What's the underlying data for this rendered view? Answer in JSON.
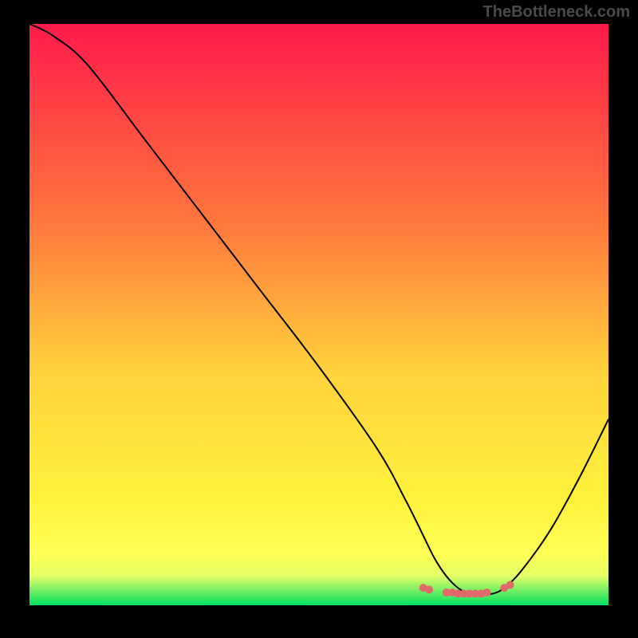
{
  "watermark": "TheBottleneck.com",
  "chart_data": {
    "type": "line",
    "title": "",
    "xlabel": "",
    "ylabel": "",
    "xlim": [
      0,
      100
    ],
    "ylim": [
      0,
      100
    ],
    "gradient_stops": [
      {
        "offset": 0,
        "color": "#ff1a4b"
      },
      {
        "offset": 35,
        "color": "#ff7a3c"
      },
      {
        "offset": 60,
        "color": "#ffd23c"
      },
      {
        "offset": 82,
        "color": "#fff23c"
      },
      {
        "offset": 91,
        "color": "#ffff55"
      },
      {
        "offset": 95,
        "color": "#e3ff66"
      },
      {
        "offset": 100,
        "color": "#00e060"
      }
    ],
    "series": [
      {
        "name": "bottleneck-curve",
        "color": "#000000",
        "x": [
          0,
          4,
          10,
          20,
          30,
          40,
          50,
          60,
          65,
          68,
          70,
          72,
          74,
          76,
          78,
          80,
          82,
          85,
          90,
          95,
          100
        ],
        "y": [
          100,
          98,
          93,
          80,
          67,
          54,
          41,
          27,
          18,
          12,
          8,
          5,
          3,
          2,
          2,
          2,
          3,
          6,
          13,
          22,
          32
        ]
      }
    ],
    "highlight_dots": {
      "name": "optimal-region",
      "color": "#e06a6a",
      "points": [
        {
          "x": 68,
          "y": 3.0
        },
        {
          "x": 69,
          "y": 2.7
        },
        {
          "x": 72,
          "y": 2.2
        },
        {
          "x": 73,
          "y": 2.2
        },
        {
          "x": 74,
          "y": 2.0
        },
        {
          "x": 75,
          "y": 2.0
        },
        {
          "x": 76,
          "y": 2.0
        },
        {
          "x": 77,
          "y": 2.0
        },
        {
          "x": 78,
          "y": 2.0
        },
        {
          "x": 79,
          "y": 2.2
        },
        {
          "x": 82,
          "y": 3.0
        },
        {
          "x": 83,
          "y": 3.5
        }
      ]
    }
  }
}
